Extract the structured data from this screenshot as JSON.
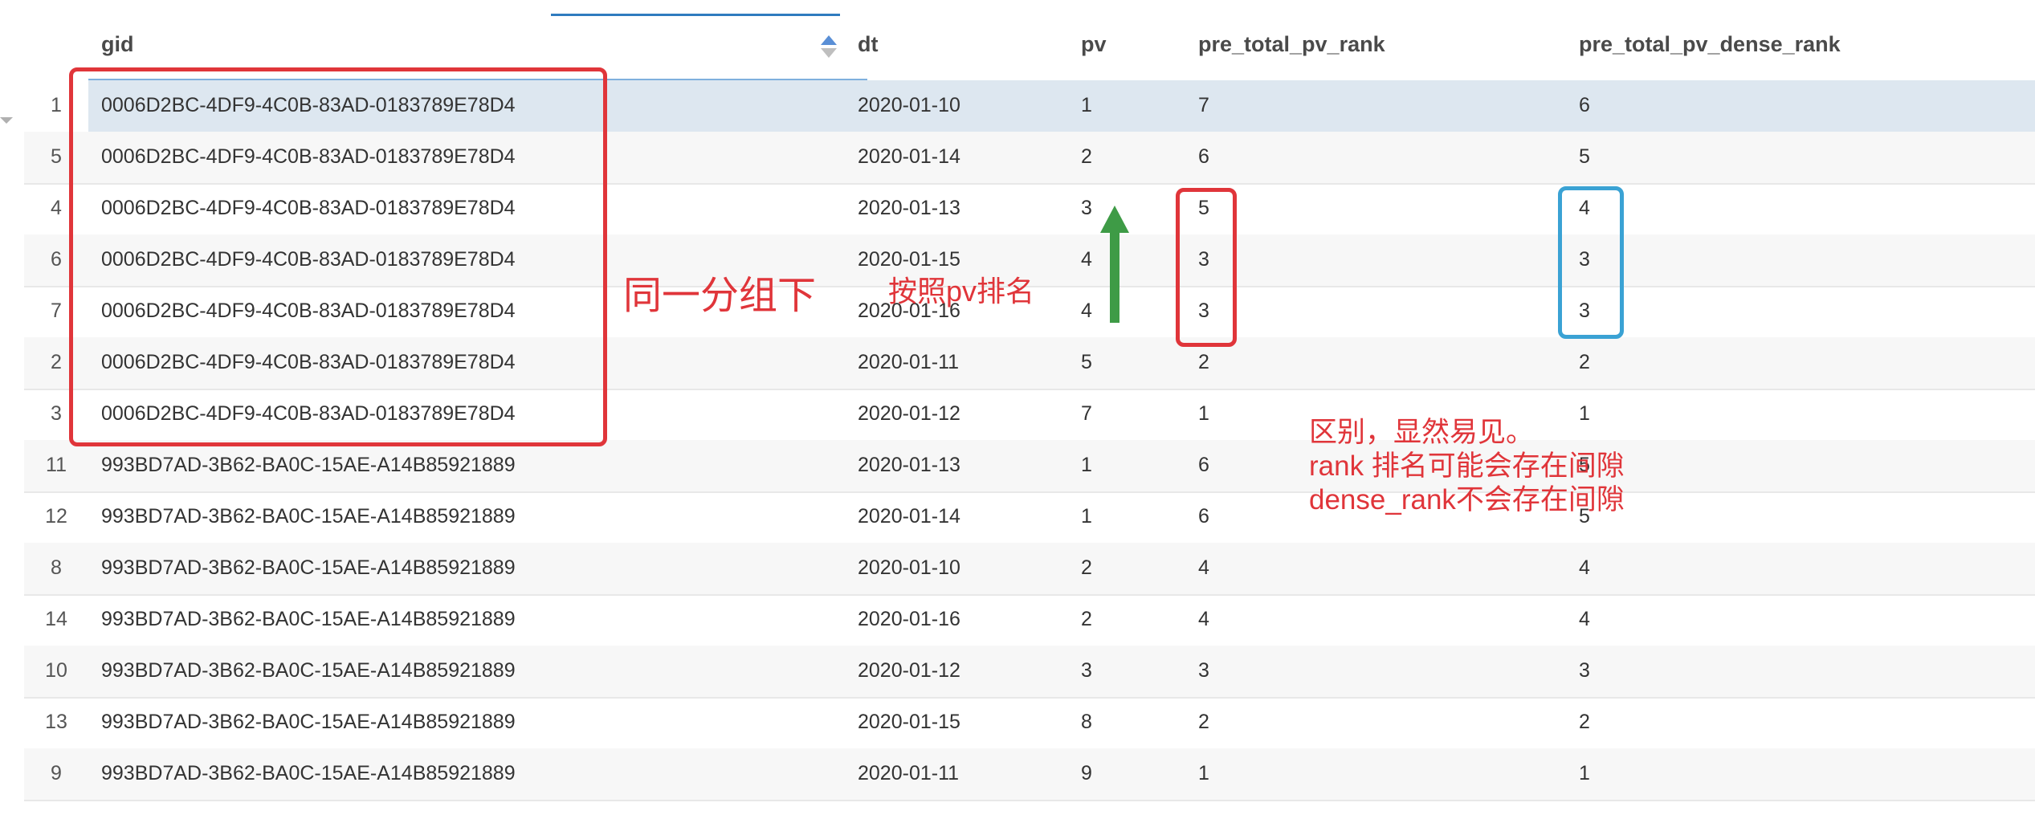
{
  "columns": {
    "gid": "gid",
    "dt": "dt",
    "pv": "pv",
    "rank": "pre_total_pv_rank",
    "drank": "pre_total_pv_dense_rank"
  },
  "rows": [
    {
      "num": "1",
      "gid": "0006D2BC-4DF9-4C0B-83AD-0183789E78D4",
      "dt": "2020-01-10",
      "pv": "1",
      "rank": "7",
      "drank": "6"
    },
    {
      "num": "5",
      "gid": "0006D2BC-4DF9-4C0B-83AD-0183789E78D4",
      "dt": "2020-01-14",
      "pv": "2",
      "rank": "6",
      "drank": "5"
    },
    {
      "num": "4",
      "gid": "0006D2BC-4DF9-4C0B-83AD-0183789E78D4",
      "dt": "2020-01-13",
      "pv": "3",
      "rank": "5",
      "drank": "4"
    },
    {
      "num": "6",
      "gid": "0006D2BC-4DF9-4C0B-83AD-0183789E78D4",
      "dt": "2020-01-15",
      "pv": "4",
      "rank": "3",
      "drank": "3"
    },
    {
      "num": "7",
      "gid": "0006D2BC-4DF9-4C0B-83AD-0183789E78D4",
      "dt": "2020-01-16",
      "pv": "4",
      "rank": "3",
      "drank": "3"
    },
    {
      "num": "2",
      "gid": "0006D2BC-4DF9-4C0B-83AD-0183789E78D4",
      "dt": "2020-01-11",
      "pv": "5",
      "rank": "2",
      "drank": "2"
    },
    {
      "num": "3",
      "gid": "0006D2BC-4DF9-4C0B-83AD-0183789E78D4",
      "dt": "2020-01-12",
      "pv": "7",
      "rank": "1",
      "drank": "1"
    },
    {
      "num": "11",
      "gid": "993BD7AD-3B62-BA0C-15AE-A14B85921889",
      "dt": "2020-01-13",
      "pv": "1",
      "rank": "6",
      "drank": "5"
    },
    {
      "num": "12",
      "gid": "993BD7AD-3B62-BA0C-15AE-A14B85921889",
      "dt": "2020-01-14",
      "pv": "1",
      "rank": "6",
      "drank": "5"
    },
    {
      "num": "8",
      "gid": "993BD7AD-3B62-BA0C-15AE-A14B85921889",
      "dt": "2020-01-10",
      "pv": "2",
      "rank": "4",
      "drank": "4"
    },
    {
      "num": "14",
      "gid": "993BD7AD-3B62-BA0C-15AE-A14B85921889",
      "dt": "2020-01-16",
      "pv": "2",
      "rank": "4",
      "drank": "4"
    },
    {
      "num": "10",
      "gid": "993BD7AD-3B62-BA0C-15AE-A14B85921889",
      "dt": "2020-01-12",
      "pv": "3",
      "rank": "3",
      "drank": "3"
    },
    {
      "num": "13",
      "gid": "993BD7AD-3B62-BA0C-15AE-A14B85921889",
      "dt": "2020-01-15",
      "pv": "8",
      "rank": "2",
      "drank": "2"
    },
    {
      "num": "9",
      "gid": "993BD7AD-3B62-BA0C-15AE-A14B85921889",
      "dt": "2020-01-11",
      "pv": "9",
      "rank": "1",
      "drank": "1"
    }
  ],
  "annotations": {
    "group": "同一分组下",
    "pv_rank": "按照pv排名",
    "diff_line1": "区别，显然易见。",
    "diff_line2": "rank 排名可能会存在间隙",
    "diff_line3": "dense_rank不会存在间隙"
  },
  "colors": {
    "highlight_red": "#e0353a",
    "highlight_blue": "#3aa2d4",
    "arrow_green": "#3e9b46",
    "selected_row": "#dde7f0"
  },
  "sort": {
    "column": "gid",
    "direction": "ascending"
  },
  "selected_row_index": 0
}
